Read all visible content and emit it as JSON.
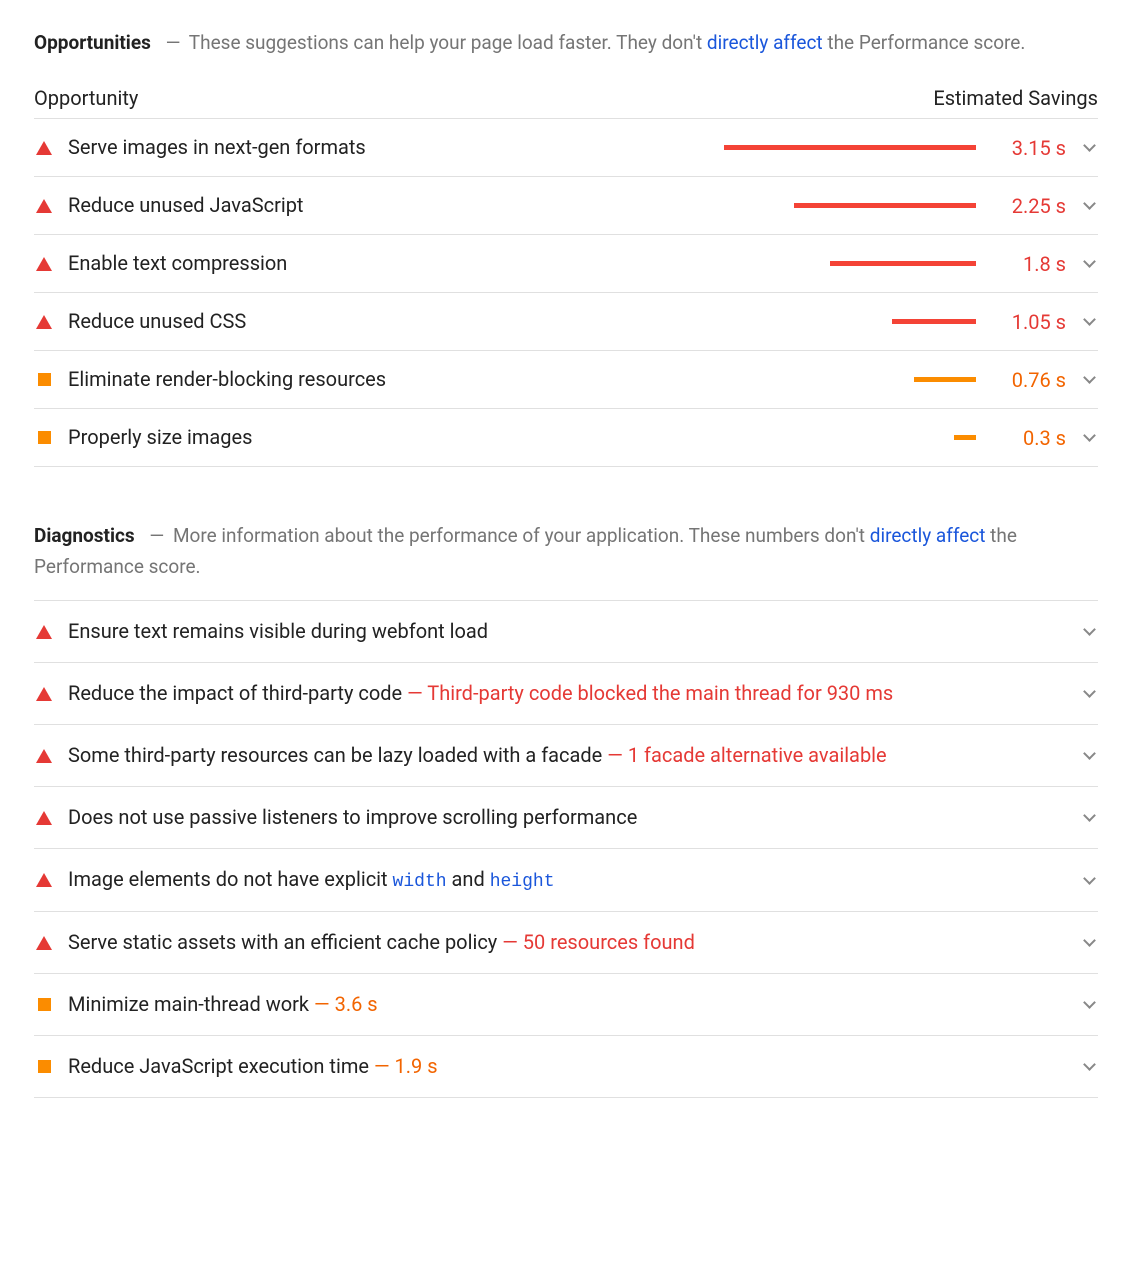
{
  "opportunities": {
    "title": "Opportunities",
    "desc_pre": "These suggestions can help your page load faster. They don't ",
    "desc_link": "directly affect",
    "desc_post": " the Performance score.",
    "col_opportunity": "Opportunity",
    "col_savings": "Estimated Savings",
    "items": [
      {
        "label": "Serve images in next-gen formats",
        "value": "3.15 s",
        "severity": "red",
        "bar_pct": 90
      },
      {
        "label": "Reduce unused JavaScript",
        "value": "2.25 s",
        "severity": "red",
        "bar_pct": 65
      },
      {
        "label": "Enable text compression",
        "value": "1.8 s",
        "severity": "red",
        "bar_pct": 52
      },
      {
        "label": "Reduce unused CSS",
        "value": "1.05 s",
        "severity": "red",
        "bar_pct": 30
      },
      {
        "label": "Eliminate render-blocking resources",
        "value": "0.76 s",
        "severity": "orange",
        "bar_pct": 22
      },
      {
        "label": "Properly size images",
        "value": "0.3 s",
        "severity": "orange",
        "bar_pct": 8
      }
    ]
  },
  "diagnostics": {
    "title": "Diagnostics",
    "desc_pre": "More information about the performance of your application. These numbers don't ",
    "desc_link": "directly affect",
    "desc_post": " the Performance score.",
    "items": [
      {
        "severity": "red",
        "label": "Ensure text remains visible during webfont load"
      },
      {
        "severity": "red",
        "label": "Reduce the impact of third-party code",
        "detail": "Third-party code blocked the main thread for 930 ms",
        "detail_color": "red"
      },
      {
        "severity": "red",
        "label": "Some third-party resources can be lazy loaded with a facade",
        "detail": "1 facade alternative available",
        "detail_color": "red"
      },
      {
        "severity": "red",
        "label": "Does not use passive listeners to improve scrolling performance"
      },
      {
        "severity": "red",
        "label_html": "Image elements do not have explicit <span class=\"code\">width</span> and <span class=\"code\">height</span>"
      },
      {
        "severity": "red",
        "label": "Serve static assets with an efficient cache policy",
        "detail": "50 resources found",
        "detail_color": "red"
      },
      {
        "severity": "orange",
        "label": "Minimize main-thread work",
        "detail": "3.6 s",
        "detail_color": "orange"
      },
      {
        "severity": "orange",
        "label": "Reduce JavaScript execution time",
        "detail": "1.9 s",
        "detail_color": "orange"
      }
    ]
  }
}
